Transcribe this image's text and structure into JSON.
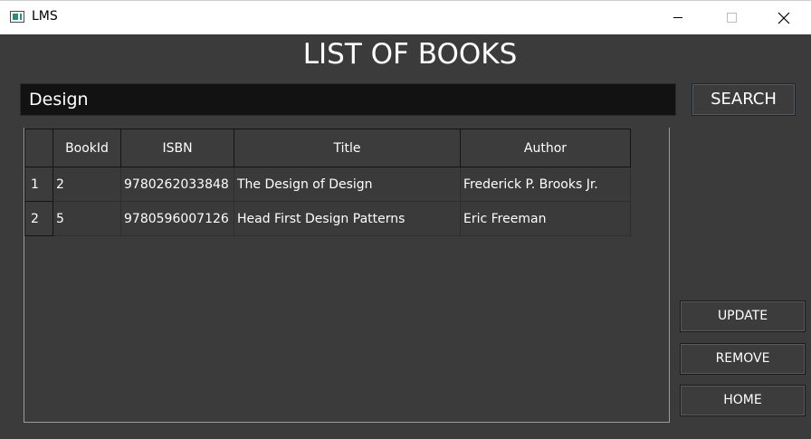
{
  "window": {
    "title": "LMS"
  },
  "page": {
    "heading": "LIST OF BOOKS"
  },
  "search": {
    "value": "Design",
    "button_label": "SEARCH"
  },
  "table": {
    "columns": [
      "BookId",
      "ISBN",
      "Title",
      "Author"
    ],
    "rows": [
      {
        "index": "1",
        "BookId": "2",
        "ISBN": "9780262033848",
        "Title": "The Design of Design",
        "Author": "Frederick P. Brooks Jr."
      },
      {
        "index": "2",
        "BookId": "5",
        "ISBN": "9780596007126",
        "Title": "Head First Design Patterns",
        "Author": "Eric Freeman"
      }
    ]
  },
  "actions": {
    "update_label": "UPDATE",
    "remove_label": "REMOVE",
    "home_label": "HOME"
  },
  "icons": {
    "app": "app-window-icon",
    "minimize": "minimize-icon",
    "maximize": "maximize-icon",
    "close": "close-icon"
  },
  "colors": {
    "background": "#3b3b3b",
    "input_background": "#121212",
    "text": "#ffffff"
  }
}
